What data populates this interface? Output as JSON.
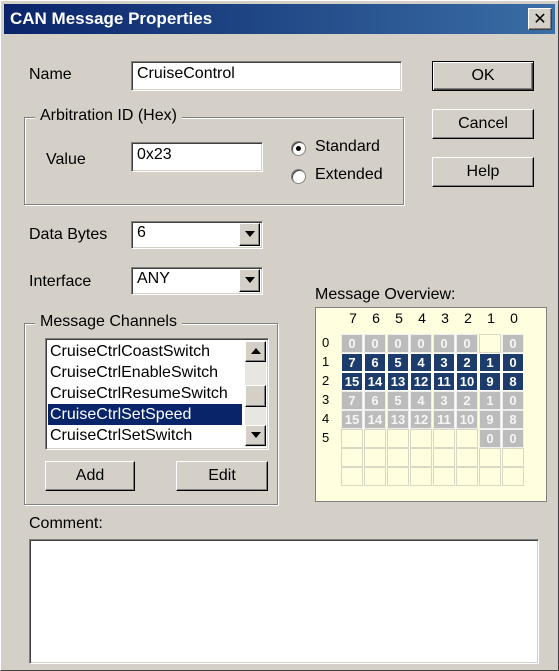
{
  "window": {
    "title": "CAN Message Properties"
  },
  "name_field": {
    "label": "Name",
    "value": "CruiseControl"
  },
  "buttons": {
    "ok": "OK",
    "cancel": "Cancel",
    "help": "Help",
    "add": "Add",
    "edit": "Edit"
  },
  "arbitration": {
    "group_label": "Arbitration ID (Hex)",
    "value_label": "Value",
    "value": "0x23",
    "standard_label": "Standard",
    "extended_label": "Extended",
    "selected": "standard"
  },
  "data_bytes": {
    "label": "Data Bytes",
    "value": "6"
  },
  "interface": {
    "label": "Interface",
    "value": "ANY"
  },
  "channels": {
    "group_label": "Message Channels",
    "items": [
      "CruiseCtrlCoastSwitch",
      "CruiseCtrlEnableSwitch",
      "CruiseCtrlResumeSwitch",
      "CruiseCtrlSetSpeed",
      "CruiseCtrlSetSwitch"
    ],
    "selected_index": 3
  },
  "overview": {
    "label": "Message Overview:",
    "columns": [
      "7",
      "6",
      "5",
      "4",
      "3",
      "2",
      "1",
      "0"
    ],
    "rows": [
      {
        "label": "0",
        "cells": [
          [
            "0",
            "off"
          ],
          [
            "0",
            "off"
          ],
          [
            "0",
            "off"
          ],
          [
            "0",
            "off"
          ],
          [
            "0",
            "off"
          ],
          [
            "0",
            "off"
          ],
          [
            "",
            ""
          ],
          [
            "0",
            "off"
          ]
        ]
      },
      {
        "label": "1",
        "cells": [
          [
            "7",
            "on"
          ],
          [
            "6",
            "on"
          ],
          [
            "5",
            "on"
          ],
          [
            "4",
            "on"
          ],
          [
            "3",
            "on"
          ],
          [
            "2",
            "on"
          ],
          [
            "1",
            "on"
          ],
          [
            "0",
            "on"
          ]
        ]
      },
      {
        "label": "2",
        "cells": [
          [
            "15",
            "on"
          ],
          [
            "14",
            "on"
          ],
          [
            "13",
            "on"
          ],
          [
            "12",
            "on"
          ],
          [
            "11",
            "on"
          ],
          [
            "10",
            "on"
          ],
          [
            "9",
            "on"
          ],
          [
            "8",
            "on"
          ]
        ]
      },
      {
        "label": "3",
        "cells": [
          [
            "7",
            "off"
          ],
          [
            "6",
            "off"
          ],
          [
            "5",
            "off"
          ],
          [
            "4",
            "off"
          ],
          [
            "3",
            "off"
          ],
          [
            "2",
            "off"
          ],
          [
            "1",
            "off"
          ],
          [
            "0",
            "off"
          ]
        ]
      },
      {
        "label": "4",
        "cells": [
          [
            "15",
            "off"
          ],
          [
            "14",
            "off"
          ],
          [
            "13",
            "off"
          ],
          [
            "12",
            "off"
          ],
          [
            "11",
            "off"
          ],
          [
            "10",
            "off"
          ],
          [
            "9",
            "off"
          ],
          [
            "8",
            "off"
          ]
        ]
      },
      {
        "label": "5",
        "cells": [
          [
            "",
            ""
          ],
          [
            "",
            ""
          ],
          [
            "",
            ""
          ],
          [
            "",
            ""
          ],
          [
            "",
            ""
          ],
          [
            "",
            ""
          ],
          [
            "0",
            "off"
          ],
          [
            "0",
            "off"
          ]
        ]
      },
      {
        "label": "",
        "cells": [
          [
            "",
            ""
          ],
          [
            "",
            ""
          ],
          [
            "",
            ""
          ],
          [
            "",
            ""
          ],
          [
            "",
            ""
          ],
          [
            "",
            ""
          ],
          [
            "",
            ""
          ],
          [
            "",
            ""
          ]
        ]
      },
      {
        "label": "",
        "cells": [
          [
            "",
            ""
          ],
          [
            "",
            ""
          ],
          [
            "",
            ""
          ],
          [
            "",
            ""
          ],
          [
            "",
            ""
          ],
          [
            "",
            ""
          ],
          [
            "",
            ""
          ],
          [
            "",
            ""
          ]
        ]
      }
    ],
    "colors": {
      "on": "#1c3c6c",
      "off": "#bcbcbc",
      "background": "#ffffdf"
    }
  },
  "comment": {
    "label": "Comment:",
    "value": ""
  },
  "icons": {
    "close": "close-icon",
    "dropdown": "chevron-down-icon",
    "scroll_up": "arrow-up-icon",
    "scroll_down": "arrow-down-icon"
  }
}
